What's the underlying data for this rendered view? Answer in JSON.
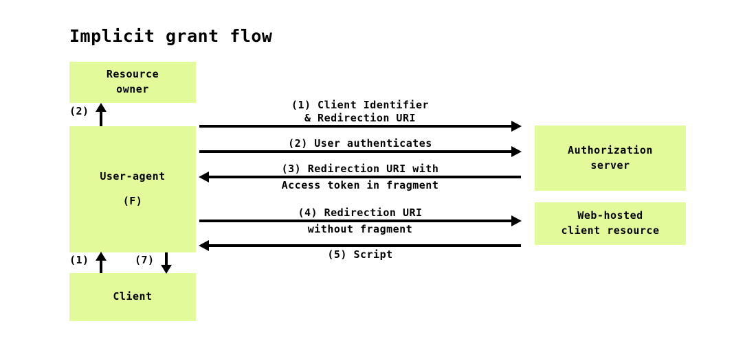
{
  "diagram": {
    "title": "Implicit grant flow",
    "background_color": "#ffffff",
    "box_fill_color": "#e3fa9b",
    "stroke_color": "#000000"
  },
  "entities": [
    {
      "id": "resource-owner",
      "line1": "Resource",
      "line2": "owner"
    },
    {
      "id": "user-agent",
      "line1": "User-agent",
      "line2": "(F)"
    },
    {
      "id": "client",
      "line1": "Client",
      "line2": ""
    },
    {
      "id": "authorization-server",
      "line1": "Authorization",
      "line2": "server"
    },
    {
      "id": "web-hosted-client-resource",
      "line1": "Web-hosted",
      "line2": "client resource"
    }
  ],
  "flows": [
    {
      "id": "flow-1",
      "step": "(1)",
      "direction": "right",
      "from": "user-agent",
      "to": "authorization-server",
      "label_above_1": "(1) Client Identifier",
      "label_above_2": "& Redirection URI",
      "label_below": ""
    },
    {
      "id": "flow-2",
      "step": "(2)",
      "direction": "right",
      "from": "user-agent",
      "to": "authorization-server",
      "label_above_1": "(2) User authenticates",
      "label_above_2": "",
      "label_below": ""
    },
    {
      "id": "flow-3",
      "step": "(3)",
      "direction": "left",
      "from": "authorization-server",
      "to": "user-agent",
      "label_above_1": "(3) Redirection URI with",
      "label_above_2": "",
      "label_below": "Access token in fragment"
    },
    {
      "id": "flow-4",
      "step": "(4)",
      "direction": "right",
      "from": "user-agent",
      "to": "web-hosted-client-resource",
      "label_above_1": "(4) Redirection URI",
      "label_above_2": "",
      "label_below": "without fragment"
    },
    {
      "id": "flow-5",
      "step": "(5)",
      "direction": "left",
      "from": "web-hosted-client-resource",
      "to": "user-agent",
      "label_above_1": "",
      "label_above_2": "",
      "label_below": "(5) Script"
    }
  ],
  "vertical_flows": [
    {
      "id": "vflow-2",
      "step": "(2)",
      "direction": "up",
      "from": "user-agent",
      "to": "resource-owner"
    },
    {
      "id": "vflow-1",
      "step": "(1)",
      "direction": "up",
      "from": "client",
      "to": "user-agent"
    },
    {
      "id": "vflow-7",
      "step": "(7)",
      "direction": "down",
      "from": "user-agent",
      "to": "client"
    }
  ]
}
